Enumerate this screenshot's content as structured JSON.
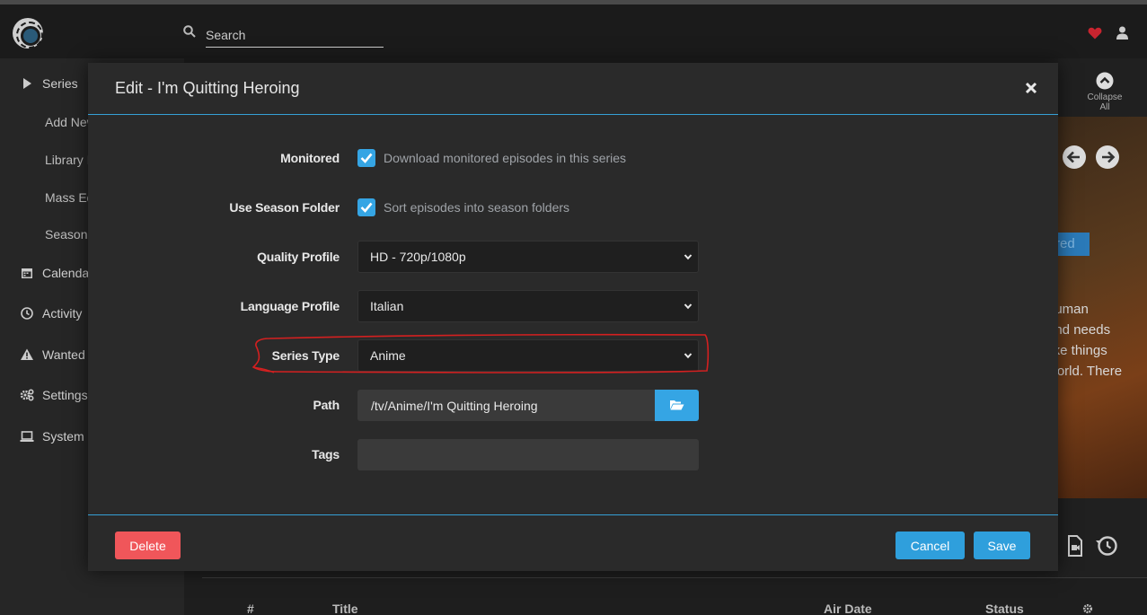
{
  "header": {
    "search_placeholder": "Search"
  },
  "sidebar": {
    "items": [
      {
        "label": "Series",
        "icon": "play-icon"
      },
      {
        "label": "Calendar",
        "icon": "calendar-icon"
      },
      {
        "label": "Activity",
        "icon": "clock-icon"
      },
      {
        "label": "Wanted",
        "icon": "warning-icon"
      },
      {
        "label": "Settings",
        "icon": "gears-icon"
      },
      {
        "label": "System",
        "icon": "laptop-icon"
      }
    ],
    "sub_items": [
      "Add New",
      "Library Import",
      "Mass Editor",
      "Season Pass"
    ]
  },
  "background": {
    "collapse_label": "Collapse All",
    "monitored_tag": "Monitored",
    "overview_lines": [
      "human",
      "and needs",
      "like things",
      "world. There"
    ],
    "table_headers": {
      "number": "#",
      "title": "Title",
      "air_date": "Air Date",
      "status": "Status"
    }
  },
  "modal": {
    "title": "Edit - I'm Quitting Heroing",
    "fields": {
      "monitored": {
        "label": "Monitored",
        "help": "Download monitored episodes in this series",
        "checked": true
      },
      "season_folder": {
        "label": "Use Season Folder",
        "help": "Sort episodes into season folders",
        "checked": true
      },
      "quality_profile": {
        "label": "Quality Profile",
        "value": "HD - 720p/1080p"
      },
      "language_profile": {
        "label": "Language Profile",
        "value": "Italian"
      },
      "series_type": {
        "label": "Series Type",
        "value": "Anime"
      },
      "path": {
        "label": "Path",
        "value": "/tv/Anime/I'm Quitting Heroing"
      },
      "tags": {
        "label": "Tags",
        "value": ""
      }
    },
    "buttons": {
      "delete": "Delete",
      "cancel": "Cancel",
      "save": "Save"
    }
  },
  "colors": {
    "accent": "#35a5e4",
    "danger": "#f0565a",
    "annotation": "#d42020"
  }
}
